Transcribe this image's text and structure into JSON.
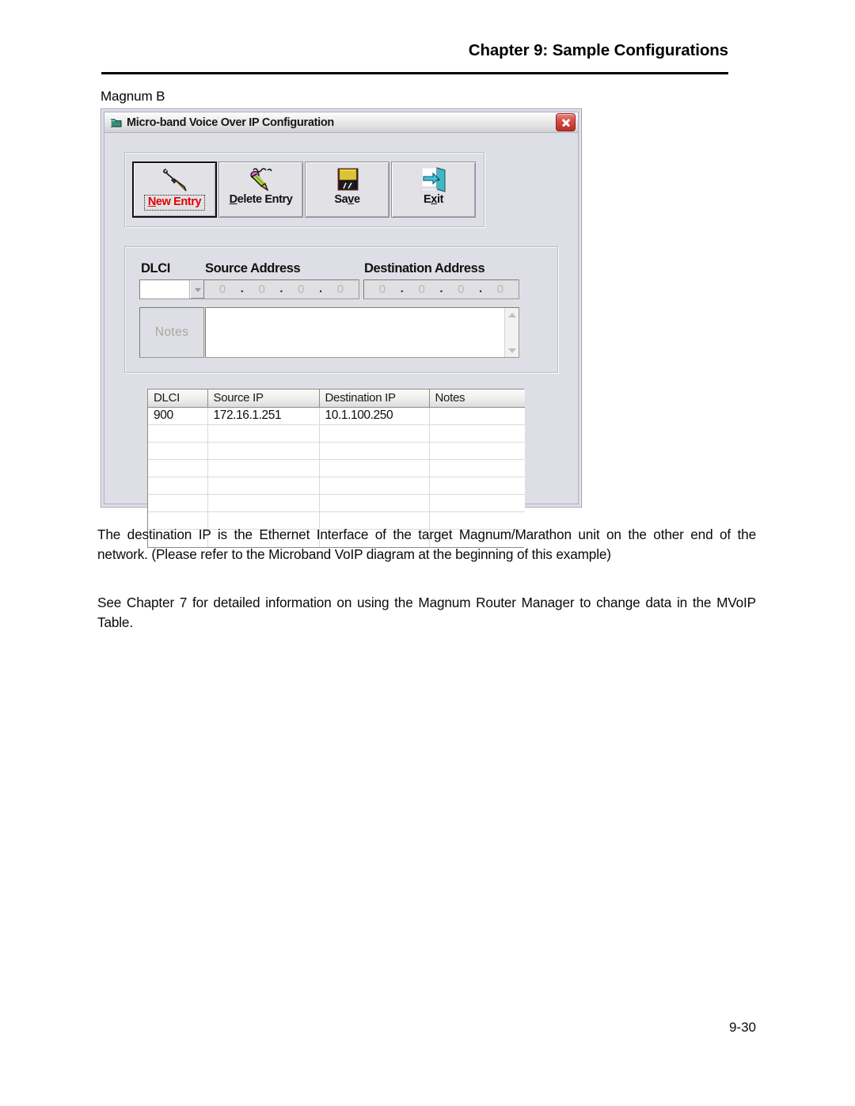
{
  "header": {
    "chapter_title": "Chapter 9: Sample Configurations"
  },
  "caption": {
    "text": "Magnum B"
  },
  "window": {
    "title": "Micro-band Voice Over IP Configuration",
    "title_icon": "folder-icon",
    "close_icon": "close-icon",
    "toolbar": {
      "buttons": [
        {
          "label_before": "N",
          "label_key": "N",
          "label_after": "ew Entry",
          "full": "New Entry",
          "icon": "pen-writing-icon",
          "accent": "#e00000",
          "default": true
        },
        {
          "label_before": "D",
          "label_key": "D",
          "label_after": "elete Entry",
          "full": "Delete Entry",
          "icon": "pencil-eraser-icon",
          "accent": "#111111",
          "default": false
        },
        {
          "label_before": "Sa",
          "label_key": "v",
          "label_after": "e",
          "full": "Save",
          "icon": "floppy-disk-icon",
          "accent": "#111111",
          "default": false
        },
        {
          "label_before": "E",
          "label_key": "x",
          "label_after": "it",
          "full": "Exit",
          "icon": "exit-door-icon",
          "accent": "#111111",
          "default": false
        }
      ]
    },
    "form": {
      "dlci_label": "DLCI",
      "dlci_value": "",
      "source_label": "Source Address",
      "destination_label": "Destination Address",
      "source_octets": [
        "0",
        "0",
        "0",
        "0"
      ],
      "destination_octets": [
        "0",
        "0",
        "0",
        "0"
      ],
      "ip_separator": ".",
      "notes_label": "Notes",
      "notes_value": ""
    },
    "grid": {
      "columns": [
        "DLCI",
        "Source IP",
        "Destination IP",
        "Notes"
      ],
      "rows": [
        [
          "900",
          "172.16.1.251",
          "10.1.100.250",
          ""
        ],
        [
          "",
          "",
          "",
          ""
        ],
        [
          "",
          "",
          "",
          ""
        ],
        [
          "",
          "",
          "",
          ""
        ],
        [
          "",
          "",
          "",
          ""
        ],
        [
          "",
          "",
          "",
          ""
        ],
        [
          "",
          "",
          "",
          ""
        ],
        [
          "",
          "",
          "",
          ""
        ]
      ]
    }
  },
  "body": {
    "paragraph_1": "The destination IP is the Ethernet Interface of the target Magnum/Marathon unit on the other end of the network.  (Please refer to the Microband VoIP diagram at the beginning of this example)",
    "paragraph_2": "See Chapter 7 for detailed information on using the Magnum Router Manager to change data in the MVoIP Table."
  },
  "footer": {
    "page_number": "9-30"
  },
  "colors": {
    "accent_red": "#e00000",
    "close_red": "#c43b33",
    "window_face": "#dedee6",
    "field_border": "#7e7e72"
  }
}
